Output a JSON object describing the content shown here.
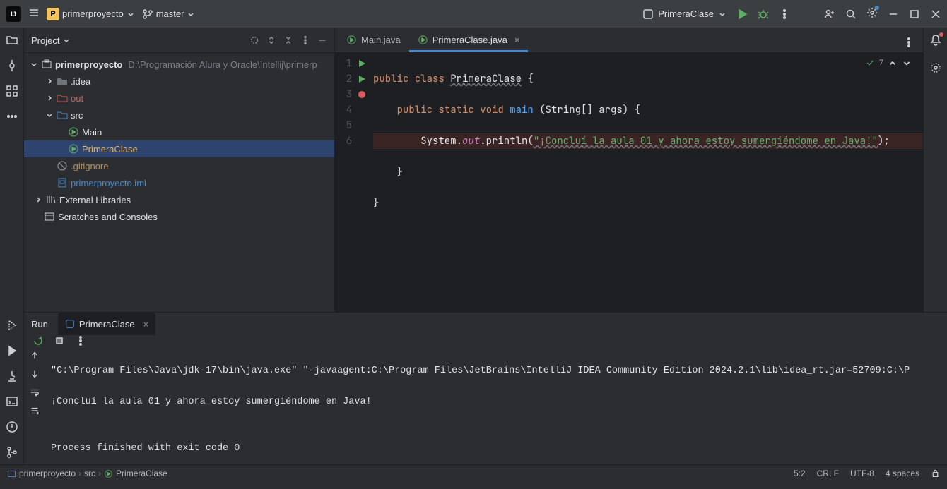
{
  "titlebar": {
    "project": "primerproyecto",
    "branch": "master",
    "runconfig": "PrimeraClase"
  },
  "sidebar": {
    "title": "Project",
    "root": {
      "name": "primerproyecto",
      "path": "D:\\Programación Alura y Oracle\\Intellij\\primerp"
    },
    "idea": ".idea",
    "out": "out",
    "src": "src",
    "main": "Main",
    "primera": "PrimeraClase",
    "gitignore": ".gitignore",
    "iml": "primerproyecto.iml",
    "extlib": "External Libraries",
    "scratch": "Scratches and Consoles"
  },
  "tabs": {
    "t1": "Main.java",
    "t2": "PrimeraClase.java"
  },
  "code": {
    "l1_a": "public class ",
    "l1_b": "PrimeraClase",
    "l1_c": " {",
    "l2_a": "    public static void ",
    "l2_m": "main",
    "l2_b": " (String[] args) {",
    "l3_a": "        System.",
    "l3_out": "out",
    "l3_b": ".println(",
    "l3_s": "\"¡Concluí la aula 01 y ahora estoy sumergiéndome en Java!\"",
    "l3_c": ");",
    "l4": "    }",
    "l5": "}"
  },
  "inspection": {
    "count": "7"
  },
  "runpanel": {
    "title": "Run",
    "tab": "PrimeraClase",
    "out1": "\"C:\\Program Files\\Java\\jdk-17\\bin\\java.exe\" \"-javaagent:C:\\Program Files\\JetBrains\\IntelliJ IDEA Community Edition 2024.2.1\\lib\\idea_rt.jar=52709:C:\\P",
    "out2": "¡Concluí la aula 01 y ahora estoy sumergiéndome en Java!",
    "out3": "",
    "out4": "Process finished with exit code 0"
  },
  "breadcrumb": {
    "p1": "primerproyecto",
    "p2": "src",
    "p3": "PrimeraClase"
  },
  "status": {
    "pos": "5:2",
    "le": "CRLF",
    "enc": "UTF-8",
    "indent": "4 spaces"
  }
}
